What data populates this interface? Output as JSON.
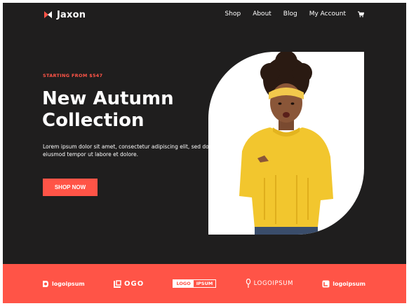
{
  "brand": {
    "name": "Jaxon",
    "accent": "#ff5447",
    "background": "#1f1e1e"
  },
  "nav": {
    "items": [
      "Shop",
      "About",
      "Blog",
      "My Account"
    ],
    "cart_icon": "shopping-cart-icon"
  },
  "hero": {
    "eyebrow": "STARTING FROM $547",
    "title_line1": "New Autumn",
    "title_line2": "Collection",
    "description": "Lorem ipsum dolor sit amet, consectetur adipiscing elit, sed do eiusmod tempor ut labore et dolore.",
    "cta_label": "SHOP NOW"
  },
  "partners": [
    {
      "icon": "logoipsum-mark-icon",
      "label": "logoipsum"
    },
    {
      "icon": "logo-square-icon",
      "label": "OGO"
    },
    {
      "label_a": "LOGO",
      "label_b": "IPSUM"
    },
    {
      "icon": "leaf-mark-icon",
      "label": "LOGOIPSUM"
    },
    {
      "icon": "logo-badge-icon",
      "label": "logoipsum"
    }
  ]
}
